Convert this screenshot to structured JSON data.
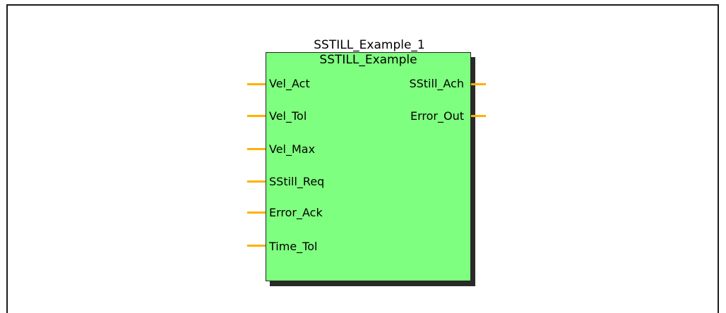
{
  "diagram": {
    "instance_name": "SSTILL_Example_1",
    "type_name": "SSTILL_Example",
    "colors": {
      "block_fill": "#7fff7f",
      "pin": "#ffb000",
      "frame": "#1a1a1a"
    },
    "inputs": [
      {
        "label": "Vel_Act"
      },
      {
        "label": "Vel_Tol"
      },
      {
        "label": "Vel_Max"
      },
      {
        "label": "SStill_Req"
      },
      {
        "label": "Error_Ack"
      },
      {
        "label": "Time_Tol"
      }
    ],
    "outputs": [
      {
        "label": "SStill_Ach"
      },
      {
        "label": "Error_Out"
      }
    ]
  }
}
